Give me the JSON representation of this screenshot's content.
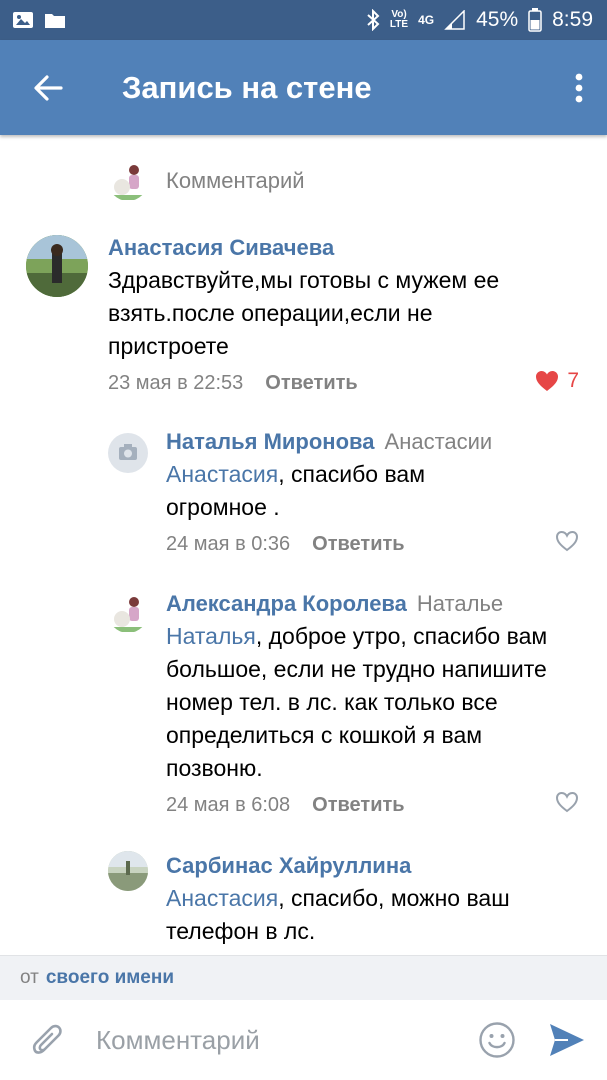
{
  "status_bar": {
    "battery": "45%",
    "time": "8:59",
    "network_top": "Vo)",
    "network_bottom": "LTE",
    "net_type": "4G",
    "icons": [
      "gallery-icon",
      "folder-icon",
      "bluetooth-icon",
      "signal-icon",
      "battery-icon"
    ]
  },
  "app_bar": {
    "title": "Запись на стене",
    "icons": [
      "back-arrow-icon",
      "more-vert-icon"
    ]
  },
  "top_comment": {
    "label": "Комментарий"
  },
  "comments": [
    {
      "author": "Анастасия Сивачева",
      "reply_to": "",
      "mention": "",
      "text": "Здравствуйте,мы готовы с мужем ее взять.после операции,если не пристроете",
      "date": "23 мая в 22:53",
      "reply_label": "Ответить",
      "likes": "7",
      "liked": true
    },
    {
      "author": "Наталья Миронова",
      "reply_to": "Анастасии",
      "mention": "Анастасия",
      "text": ", спасибо вам огромное .",
      "date": "24 мая в 0:36",
      "reply_label": "Ответить",
      "likes": "",
      "liked": false
    },
    {
      "author": "Александра Королева",
      "reply_to": "Наталье",
      "mention": "Наталья",
      "text": ", доброе утро, спасибо вам большое, если не трудно напишите номер тел. в лс. как только все определиться с кошкой я вам позвоню.",
      "date": "24 мая в 6:08",
      "reply_label": "Ответить",
      "likes": "",
      "liked": false
    },
    {
      "author": "Сарбинас Хайруллина",
      "reply_to": "",
      "mention": "Анастасия",
      "text": ", спасибо, можно ваш телефон в лс.",
      "date": "",
      "reply_label": "",
      "likes": "",
      "liked": false
    }
  ],
  "composer": {
    "from_prefix": "от",
    "from_link": "своего имени",
    "placeholder": "Комментарий"
  },
  "colors": {
    "status_bar": "#3c5e89",
    "app_bar": "#5181b8",
    "link": "#4a76a8",
    "secondary": "#828282",
    "like": "#e64646"
  }
}
